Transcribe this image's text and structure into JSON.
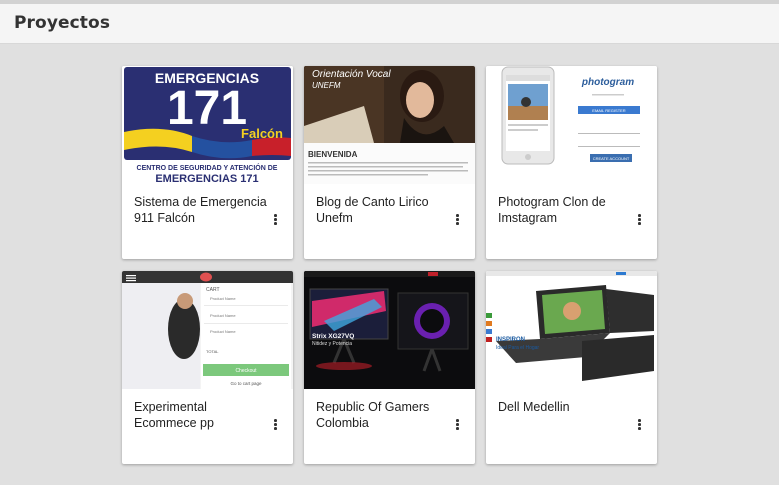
{
  "header": {
    "title": "Proyectos"
  },
  "projects": [
    {
      "title": "Sistema de Emergencia 911 Falcón",
      "thumb": {
        "line1": "EMERGENCIAS",
        "number": "171",
        "place": "Falcón",
        "footer1": "CENTRO DE SEGURIDAD Y ATENCIÓN DE",
        "footer2": "EMERGENCIAS 171"
      }
    },
    {
      "title": "Blog de Canto Lirico Unefm",
      "thumb": {
        "heading": "Orientación Vocal",
        "sub": "UNEFM",
        "section": "BIENVENIDA"
      }
    },
    {
      "title": "Photogram Clon de Imstagram",
      "thumb": {
        "logo": "photogram",
        "button1": "EMAIL REGISTER",
        "button2": "CREATE ACCOUNT"
      }
    },
    {
      "title": "Experimental Ecommece pp",
      "thumb": {
        "cart": "CART",
        "item": "Product Name",
        "total": "TOTAL",
        "checkout": "Checkout",
        "continue": "Go to cart page"
      }
    },
    {
      "title": "Republic Of Gamers Colombia",
      "thumb": {
        "model": "Strix XG27VQ",
        "tagline": "Nitidez y Potencia"
      }
    },
    {
      "title": "Dell Medellin",
      "thumb": {
        "brand": "INSPIRON",
        "tagline": "Ideal Para el Hogar"
      }
    }
  ]
}
